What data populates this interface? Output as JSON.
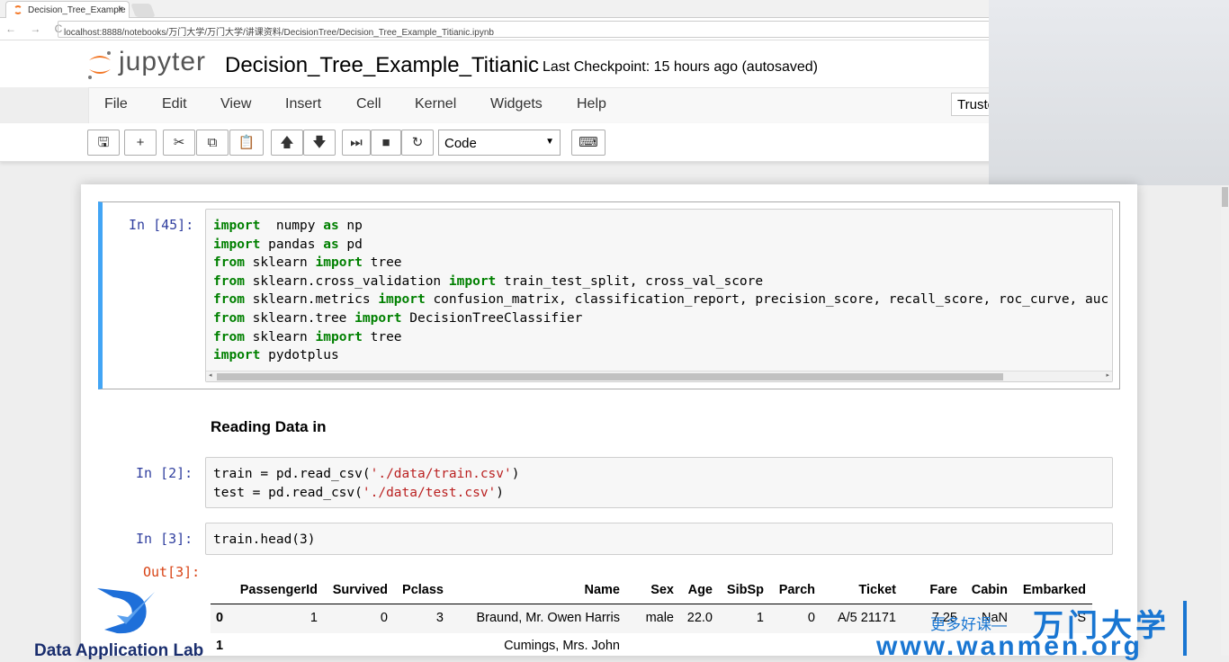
{
  "browser": {
    "tab_title": "Decision_Tree_Example",
    "tab_close": "×",
    "url": "localhost:8888/notebooks/万门大学/万门大学/讲课资料/DecisionTree/Decision_Tree_Example_Titianic.ipynb",
    "nav": "← → C"
  },
  "header": {
    "logo_text": "jupyter",
    "notebook_title": "Decision_Tree_Example_Titianic",
    "checkpoint": "Last Checkpoint: 15 hours ago (autosaved)"
  },
  "menu": [
    "File",
    "Edit",
    "View",
    "Insert",
    "Cell",
    "Kernel",
    "Widgets",
    "Help"
  ],
  "trusted_label": "Trusted",
  "toolbar": {
    "buttons": [
      {
        "icon": "save-icon",
        "glyph": "🖫"
      },
      {
        "icon": "plus-icon",
        "glyph": "+"
      },
      {
        "icon": "cut-icon",
        "glyph": "✂"
      },
      {
        "icon": "copy-icon",
        "glyph": "⧉"
      },
      {
        "icon": "paste-icon",
        "glyph": "📋"
      },
      {
        "icon": "arrow-up-icon",
        "glyph": "🡅"
      },
      {
        "icon": "arrow-down-icon",
        "glyph": "🡇"
      },
      {
        "icon": "step-forward-icon",
        "glyph": "⏭"
      },
      {
        "icon": "stop-icon",
        "glyph": "■"
      },
      {
        "icon": "refresh-icon",
        "glyph": "↻"
      },
      {
        "icon": "keyboard-icon",
        "glyph": "⌨"
      }
    ],
    "cell_type": "Code"
  },
  "cells": [
    {
      "prompt": "In [45]:",
      "lines": [
        [
          [
            "kw",
            "import"
          ],
          [
            "",
            "  numpy "
          ],
          [
            "kw",
            "as"
          ],
          [
            "",
            " np"
          ]
        ],
        [
          [
            "kw",
            "import"
          ],
          [
            "",
            " pandas "
          ],
          [
            "kw",
            "as"
          ],
          [
            "",
            " pd"
          ]
        ],
        [
          [
            "kw",
            "from"
          ],
          [
            "",
            " sklearn "
          ],
          [
            "kw",
            "import"
          ],
          [
            "",
            " tree"
          ]
        ],
        [
          [
            "kw",
            "from"
          ],
          [
            "",
            " sklearn.cross_validation "
          ],
          [
            "kw",
            "import"
          ],
          [
            "",
            " train_test_split, cross_val_score"
          ]
        ],
        [
          [
            "kw",
            "from"
          ],
          [
            "",
            " sklearn.metrics "
          ],
          [
            "kw",
            "import"
          ],
          [
            "",
            " confusion_matrix, classification_report, precision_score, recall_score, roc_curve, auc"
          ]
        ],
        [
          [
            "kw",
            "from"
          ],
          [
            "",
            " sklearn.tree "
          ],
          [
            "kw",
            "import"
          ],
          [
            "",
            " DecisionTreeClassifier"
          ]
        ],
        [
          [
            "kw",
            "from"
          ],
          [
            "",
            " sklearn "
          ],
          [
            "kw",
            "import"
          ],
          [
            "",
            " tree"
          ]
        ],
        [
          [
            "kw",
            "import"
          ],
          [
            "",
            " pydotplus"
          ]
        ]
      ]
    },
    {
      "markdown": "Reading Data in"
    },
    {
      "prompt": "In [2]:",
      "lines": [
        [
          [
            "",
            "train = pd.read_csv("
          ],
          [
            "str",
            "'./data/train.csv'"
          ],
          [
            "",
            ")"
          ]
        ],
        [
          [
            "",
            "test = pd.read_csv("
          ],
          [
            "str",
            "'./data/test.csv'"
          ],
          [
            "",
            ")"
          ]
        ]
      ]
    },
    {
      "prompt": "In [3]:",
      "lines": [
        [
          [
            "",
            "train.head(3)"
          ]
        ]
      ],
      "out_prompt": "Out[3]:"
    }
  ],
  "table": {
    "columns": [
      "",
      "PassengerId",
      "Survived",
      "Pclass",
      "Name",
      "Sex",
      "Age",
      "SibSp",
      "Parch",
      "Ticket",
      "Fare",
      "Cabin",
      "Embarked"
    ],
    "rows": [
      [
        "0",
        "1",
        "0",
        "3",
        "Braund, Mr. Owen Harris",
        "male",
        "22.0",
        "1",
        "0",
        "A/5 21171",
        "7.25",
        "NaN",
        "S"
      ],
      [
        "1",
        "",
        "",
        "",
        "Cumings, Mrs. John",
        "",
        "",
        "",
        "",
        "",
        "",
        "",
        ""
      ]
    ]
  },
  "watermarks": {
    "left": "Data Application Lab",
    "right_small": "更多好课—",
    "right_big": "万门大学",
    "right_url": "www.wanmen.org"
  },
  "colors": {
    "accent": "#42a5f5",
    "prompt_in": "#303f9f",
    "prompt_out": "#d84315",
    "keyword": "#008000",
    "string": "#ba2121"
  }
}
